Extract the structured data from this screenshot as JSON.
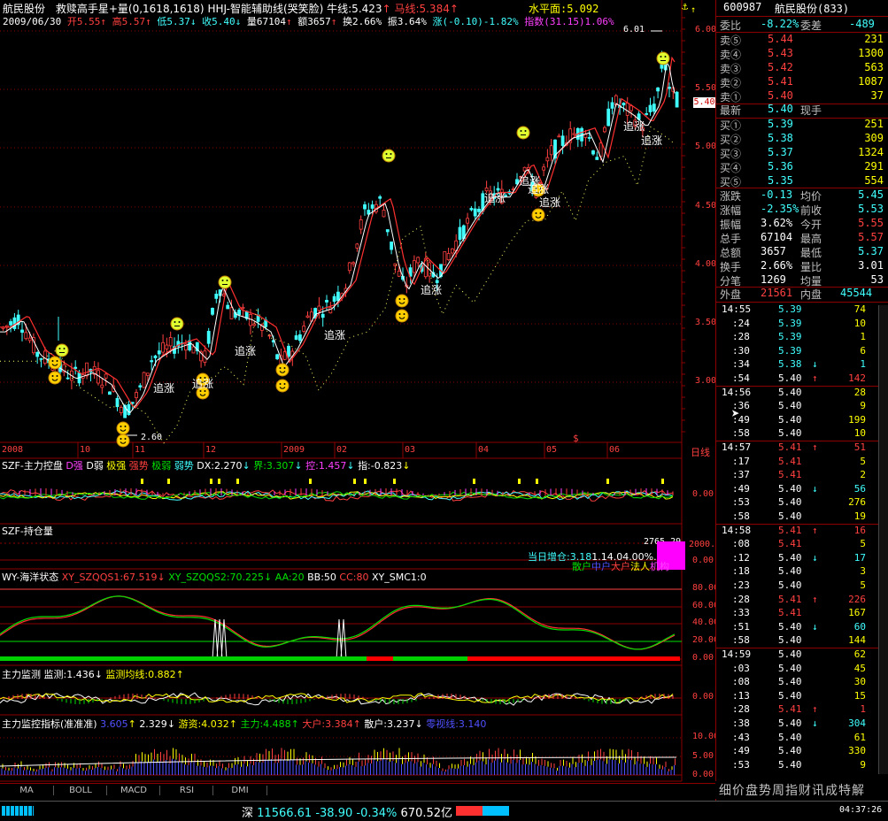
{
  "colors": {
    "up": "#ff4040",
    "down": "#40ffff",
    "grid": "#8b0000",
    "text": "#c0c0c0",
    "yellow": "#ffff00",
    "magenta": "#ff40ff",
    "green": "#00e000"
  },
  "header": {
    "stock_name": "航民股份",
    "formula": "救赎高手星+量",
    "formula_params": "(0,1618,1618)",
    "aux_line": "HHJ-智能辅助线(哭笑脸)",
    "niu_line": "牛线:5.423",
    "ma_line": "马线:5.384",
    "shuiping": "水平面:5.092",
    "date": "2009/06/30",
    "open": "开5.55",
    "high": "高5.57",
    "low": "低5.37",
    "close": "收5.40",
    "volume": "量67104",
    "amount": "额3657",
    "turnover": "换2.66%",
    "amplitude": "振3.64%",
    "change": "涨(-0.10)-1.82%",
    "index": "指数(31.15)1.06%"
  },
  "price_axis": {
    "ticks": [
      "6.00",
      "5.50",
      "5.00",
      "4.50",
      "4.00",
      "3.50",
      "3.00"
    ],
    "current": "5.40",
    "max_label": "6.01",
    "min_label": "2.60"
  },
  "chart_labels": {
    "zhuizhang": "追涨"
  },
  "time_axis": [
    "2008",
    "10",
    "11",
    "12",
    "2009",
    "02",
    "03",
    "04",
    "05",
    "06"
  ],
  "time_axis_right": "日线",
  "panel1": {
    "title": "SZF-主力控盘",
    "items": [
      "D强",
      "D弱",
      "极强",
      "强势",
      "极弱",
      "弱势",
      "DX:2.270",
      "界:3.307",
      "控:1.457",
      "指:-0.823"
    ],
    "axis": "0.00"
  },
  "panel2": {
    "title": "SZF-持仓量",
    "text1": "当日增仓:3.18",
    "text2": "1.14.04.00%.46%",
    "value": "2765.29",
    "labels": [
      "散户",
      "中户",
      "大户",
      "法人",
      "机构"
    ],
    "axis": [
      "2000.",
      "0.00"
    ]
  },
  "panel3": {
    "title": "WY-海洋状态",
    "items": [
      "XY_SZQQS1:67.519",
      "XY_SZQQS2:70.225",
      "AA:20",
      "BB:50",
      "CC:80",
      "XY_SMC1:0"
    ],
    "axis": [
      "80.00",
      "60.00",
      "40.00",
      "20.00",
      "0.00"
    ]
  },
  "panel4": {
    "title": "主力监测",
    "items": [
      "监测:1.436",
      "监测均线:0.882"
    ],
    "axis": "0.00"
  },
  "panel5": {
    "title": "主力监控指标(准准准)",
    "items": [
      "3.605",
      "2.329",
      "游资:4.032",
      "主力:4.488",
      "大户:3.384",
      "散户:3.237",
      "零视线:3.140"
    ],
    "axis": [
      "10.00",
      "5.00",
      "0.00"
    ]
  },
  "bottom_tabs": [
    "MA",
    "BOLL",
    "MACD",
    "RSI",
    "DMI"
  ],
  "status": {
    "market": "深",
    "index": "11566.61",
    "change": "-38.90",
    "pct": "-0.34%",
    "amount": "670.52亿",
    "time": "04:37:26"
  },
  "right_panel": {
    "code": "600987",
    "name": "航民股份(833)",
    "weibi_label": "委比",
    "weibi": "-8.22%",
    "weicha_label": "委差",
    "weicha": "-489",
    "asks": [
      {
        "l": "卖⑤",
        "p": "5.44",
        "v": "231"
      },
      {
        "l": "卖④",
        "p": "5.43",
        "v": "1300"
      },
      {
        "l": "卖③",
        "p": "5.42",
        "v": "563"
      },
      {
        "l": "卖②",
        "p": "5.41",
        "v": "1087"
      },
      {
        "l": "卖①",
        "p": "5.40",
        "v": "37"
      }
    ],
    "last_label": "最新",
    "last": "5.40",
    "hand_label": "现手",
    "hand": "",
    "bids": [
      {
        "l": "买①",
        "p": "5.39",
        "v": "251"
      },
      {
        "l": "买②",
        "p": "5.38",
        "v": "309"
      },
      {
        "l": "买③",
        "p": "5.37",
        "v": "1324"
      },
      {
        "l": "买④",
        "p": "5.36",
        "v": "291"
      },
      {
        "l": "买⑤",
        "p": "5.35",
        "v": "554"
      }
    ],
    "stats": [
      {
        "l1": "涨跌",
        "v1": "-0.13",
        "l2": "均价",
        "v2": "5.45"
      },
      {
        "l1": "涨幅",
        "v1": "-2.35%",
        "l2": "前收",
        "v2": "5.53"
      },
      {
        "l1": "振幅",
        "v1": "3.62%",
        "l2": "今开",
        "v2": "5.55"
      },
      {
        "l1": "总手",
        "v1": "67104",
        "l2": "最高",
        "v2": "5.57"
      },
      {
        "l1": "总额",
        "v1": "3657",
        "l2": "最低",
        "v2": "5.37"
      },
      {
        "l1": "换手",
        "v1": "2.66%",
        "l2": "量比",
        "v2": "3.01"
      },
      {
        "l1": "分笔",
        "v1": "1269",
        "l2": "均量",
        "v2": "53"
      }
    ],
    "outer_label": "外盘",
    "outer": "21561",
    "inner_label": "内盘",
    "inner": "45544",
    "ticks": [
      {
        "t": "14:55",
        "p": "5.39",
        "v": "74",
        "d": ""
      },
      {
        "t": ":24",
        "p": "5.39",
        "v": "10",
        "d": ""
      },
      {
        "t": ":28",
        "p": "5.39",
        "v": "1",
        "d": ""
      },
      {
        "t": ":30",
        "p": "5.39",
        "v": "6",
        "d": ""
      },
      {
        "t": ":34",
        "p": "5.38",
        "v": "1",
        "d": "↓"
      },
      {
        "t": ":54",
        "p": "5.40",
        "v": "142",
        "d": "↑"
      },
      {
        "t": "14:56",
        "p": "5.40",
        "v": "28",
        "d": ""
      },
      {
        "t": ":36",
        "p": "5.40",
        "v": "9",
        "d": ""
      },
      {
        "t": ":49",
        "p": "5.40",
        "v": "199",
        "d": ""
      },
      {
        "t": ":58",
        "p": "5.40",
        "v": "10",
        "d": ""
      },
      {
        "t": "14:57",
        "p": "5.41",
        "v": "51",
        "d": "↑"
      },
      {
        "t": ":17",
        "p": "5.41",
        "v": "5",
        "d": ""
      },
      {
        "t": ":37",
        "p": "5.41",
        "v": "2",
        "d": ""
      },
      {
        "t": ":49",
        "p": "5.40",
        "v": "56",
        "d": "↓"
      },
      {
        "t": ":53",
        "p": "5.40",
        "v": "276",
        "d": ""
      },
      {
        "t": ":58",
        "p": "5.40",
        "v": "19",
        "d": ""
      },
      {
        "t": "14:58",
        "p": "5.41",
        "v": "16",
        "d": "↑"
      },
      {
        "t": ":08",
        "p": "5.41",
        "v": "5",
        "d": ""
      },
      {
        "t": ":12",
        "p": "5.40",
        "v": "17",
        "d": "↓"
      },
      {
        "t": ":18",
        "p": "5.40",
        "v": "3",
        "d": ""
      },
      {
        "t": ":23",
        "p": "5.40",
        "v": "5",
        "d": ""
      },
      {
        "t": ":28",
        "p": "5.41",
        "v": "226",
        "d": "↑"
      },
      {
        "t": ":33",
        "p": "5.41",
        "v": "167",
        "d": ""
      },
      {
        "t": ":51",
        "p": "5.40",
        "v": "60",
        "d": "↓"
      },
      {
        "t": ":58",
        "p": "5.40",
        "v": "144",
        "d": ""
      },
      {
        "t": "14:59",
        "p": "5.40",
        "v": "62",
        "d": ""
      },
      {
        "t": ":03",
        "p": "5.40",
        "v": "45",
        "d": ""
      },
      {
        "t": ":08",
        "p": "5.40",
        "v": "30",
        "d": ""
      },
      {
        "t": ":13",
        "p": "5.40",
        "v": "15",
        "d": ""
      },
      {
        "t": ":28",
        "p": "5.41",
        "v": "1",
        "d": "↑"
      },
      {
        "t": ":38",
        "p": "5.40",
        "v": "304",
        "d": "↓"
      },
      {
        "t": ":43",
        "p": "5.40",
        "v": "61",
        "d": ""
      },
      {
        "t": ":49",
        "p": "5.40",
        "v": "330",
        "d": ""
      },
      {
        "t": ":53",
        "p": "5.40",
        "v": "9",
        "d": ""
      }
    ],
    "bottom_tabs": "细价盘势周指财讯成特解"
  }
}
